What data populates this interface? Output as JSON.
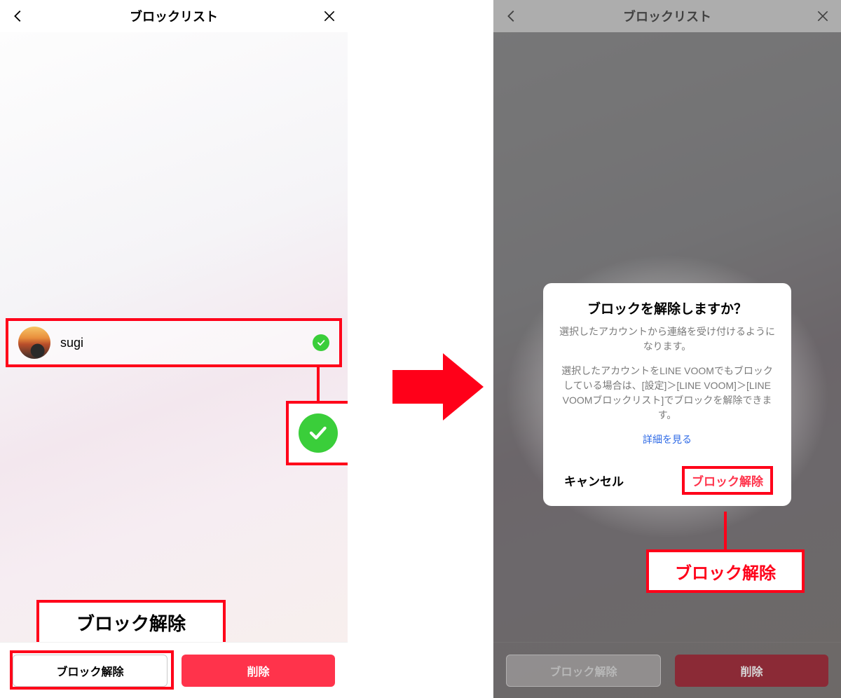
{
  "left": {
    "header": {
      "title": "ブロックリスト"
    },
    "user": {
      "name": "sugi"
    },
    "buttons": {
      "unblock": "ブロック解除",
      "delete": "削除"
    },
    "callout_label": "ブロック解除"
  },
  "right": {
    "header": {
      "title": "ブロックリスト"
    },
    "dialog": {
      "title": "ブロックを解除しますか？",
      "msg1": "選択したアカウントから連絡を受け付けるようになります。",
      "msg2": "選択したアカウントをLINE VOOMでもブロックしている場合は、[設定]＞[LINE VOOM]＞[LINE VOOMブロックリスト]でブロックを解除できます。",
      "link": "詳細を見る",
      "cancel": "キャンセル",
      "confirm": "ブロック解除"
    },
    "buttons": {
      "unblock": "ブロック解除",
      "delete": "削除"
    },
    "callout_label": "ブロック解除"
  }
}
